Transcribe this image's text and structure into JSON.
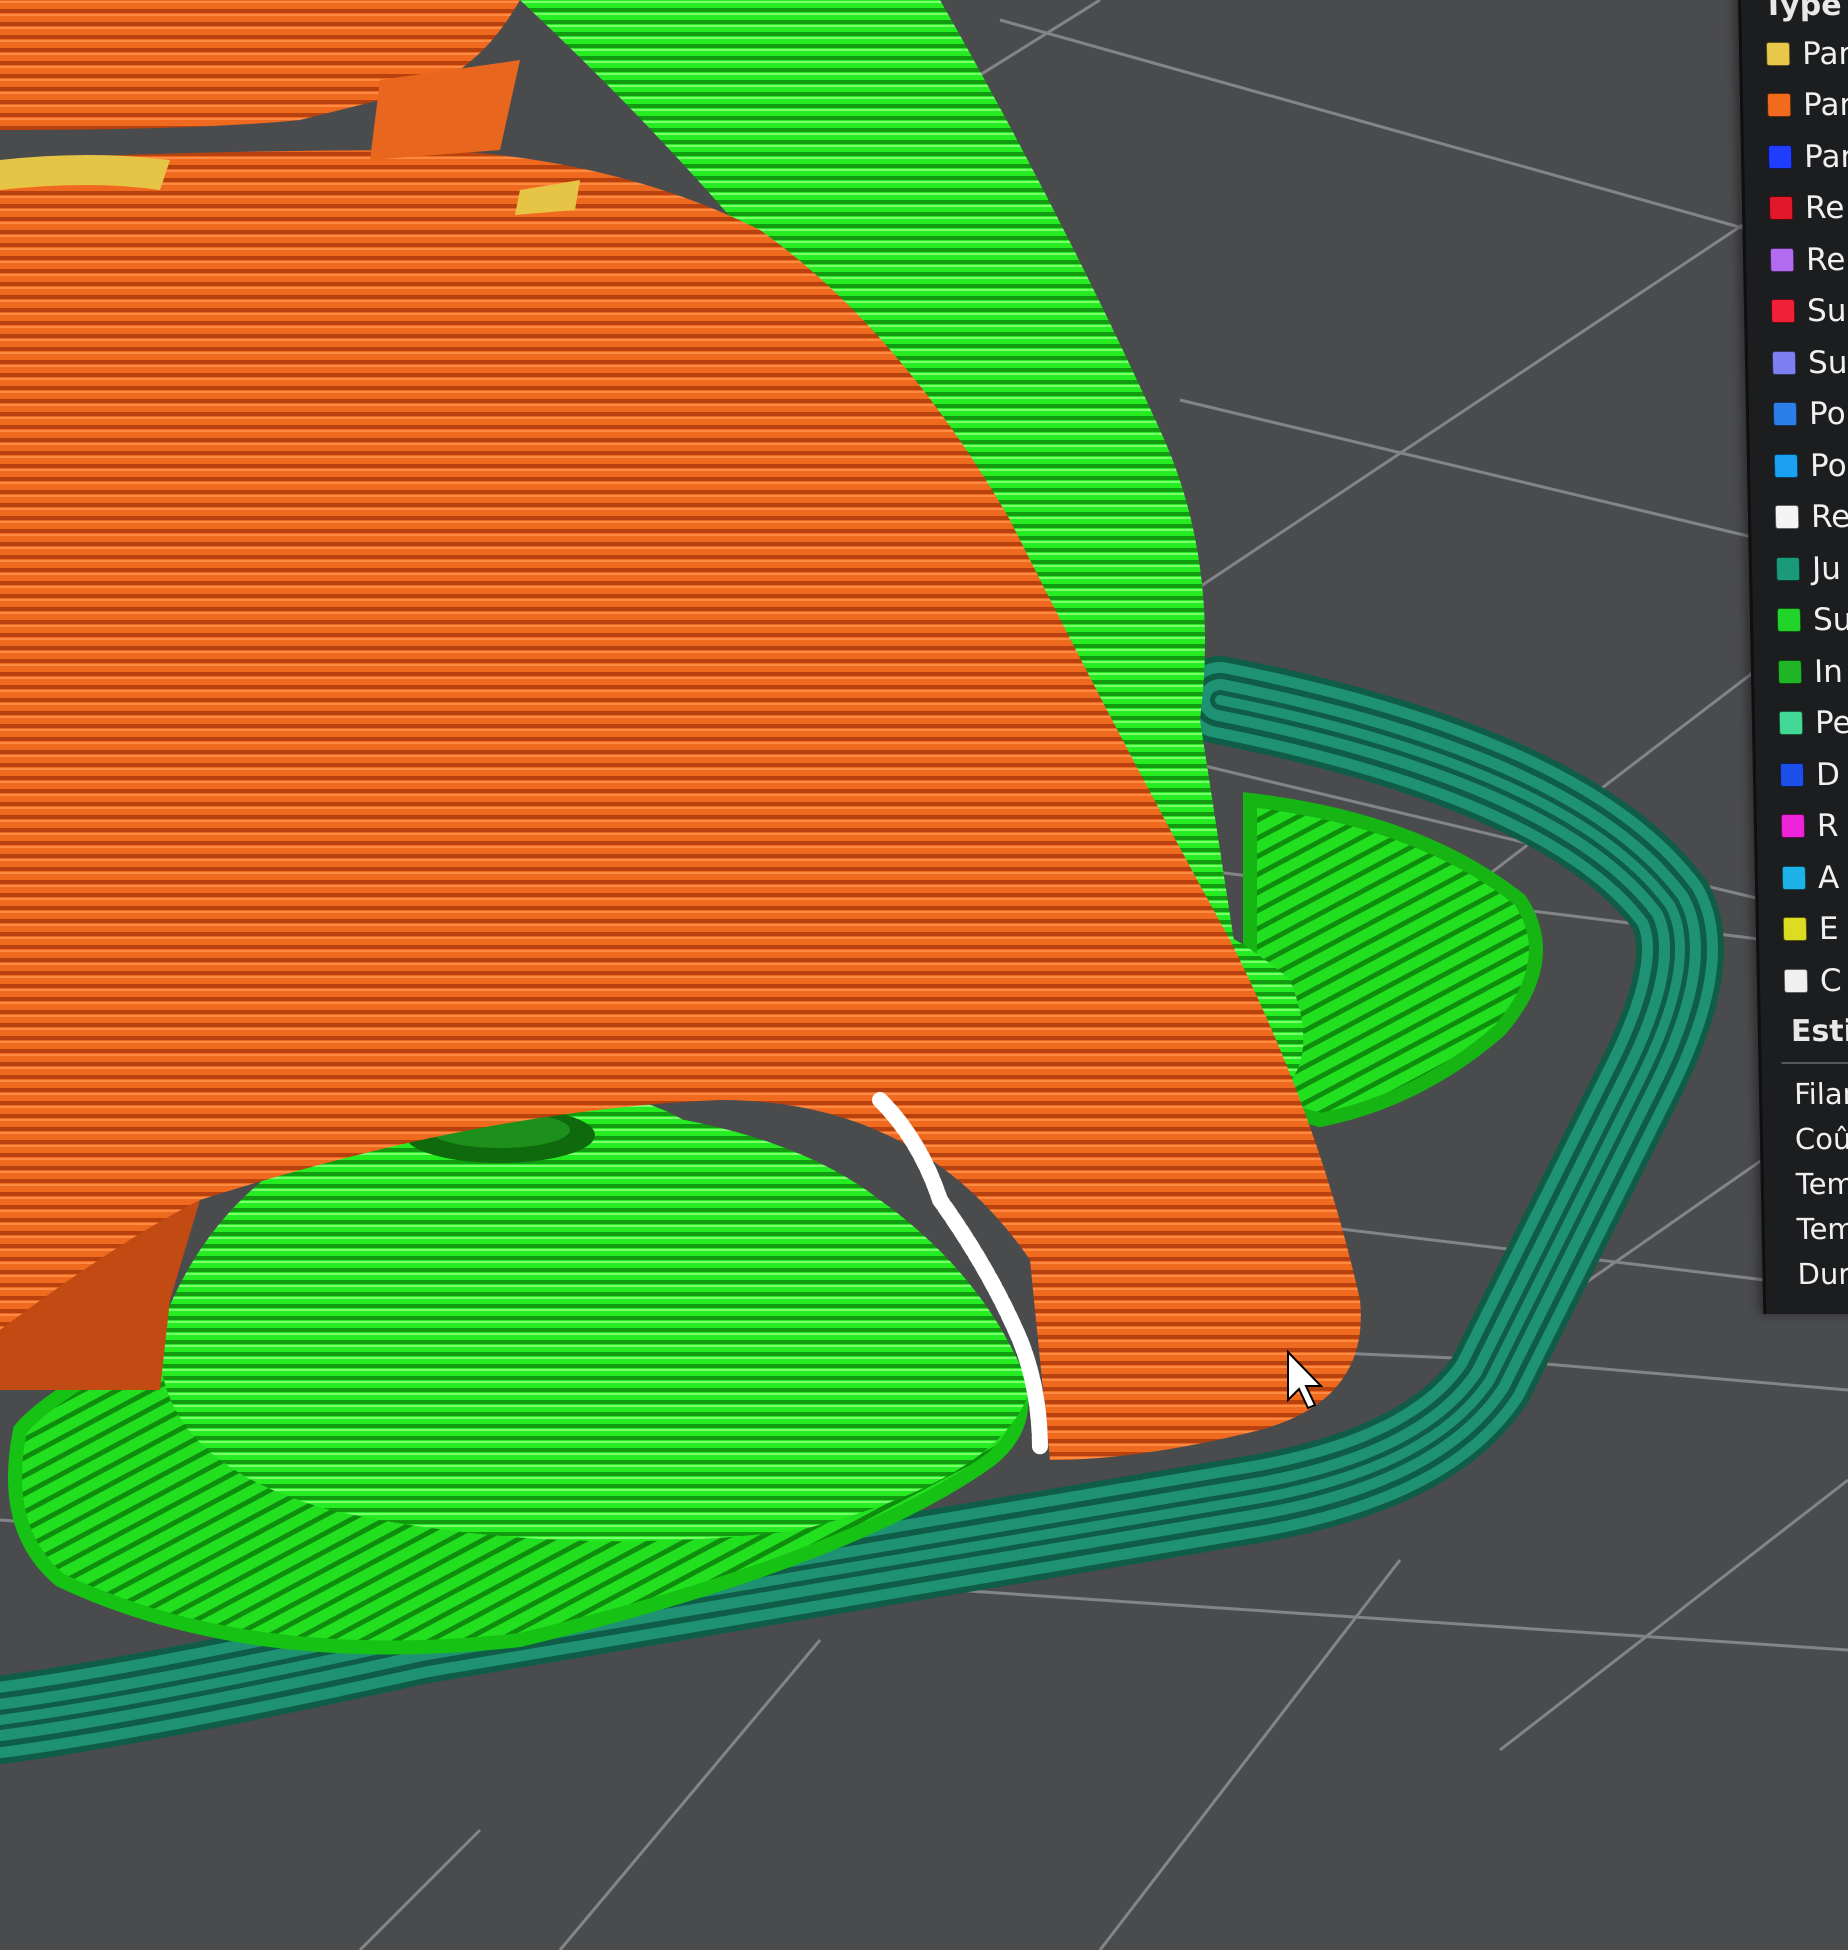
{
  "legend": {
    "title": "Type d",
    "items": [
      {
        "label": "Par",
        "color": "#e8c84a"
      },
      {
        "label": "Par",
        "color": "#f26b1d"
      },
      {
        "label": "Par",
        "color": "#1f3cff"
      },
      {
        "label": "Re",
        "color": "#e0182a"
      },
      {
        "label": "Re",
        "color": "#b36bf0"
      },
      {
        "label": "Su",
        "color": "#ef2038"
      },
      {
        "label": "Su",
        "color": "#7d80f0"
      },
      {
        "label": "Po",
        "color": "#2b7fe6"
      },
      {
        "label": "Po",
        "color": "#1aa0f0"
      },
      {
        "label": "Re",
        "color": "#f4f4f4"
      },
      {
        "label": "Ju",
        "color": "#1a9a78"
      },
      {
        "label": "Su",
        "color": "#22d32a"
      },
      {
        "label": "In",
        "color": "#1fb526"
      },
      {
        "label": "Pe",
        "color": "#44d896"
      },
      {
        "label": "D",
        "color": "#1c4ee8"
      },
      {
        "label": "R",
        "color": "#ee24d8"
      },
      {
        "label": "A",
        "color": "#1fb2e8"
      },
      {
        "label": "E",
        "color": "#dcdc22"
      },
      {
        "label": "C",
        "color": "#f0f0f0"
      }
    ]
  },
  "estimated": {
    "title": "Esti",
    "items": [
      "Filar",
      "Coû",
      "Tem",
      "Tem",
      "Dur"
    ]
  },
  "colors": {
    "perimeter_orange": "#f26b1d",
    "support_green": "#22e81f",
    "skirt_teal": "#1f8f70",
    "seam_white": "#ffffff",
    "bed_gray": "#4a4b4d",
    "grid_line": "#8a8c8e"
  },
  "cursor": {
    "icon": "mouse-pointer-icon"
  }
}
